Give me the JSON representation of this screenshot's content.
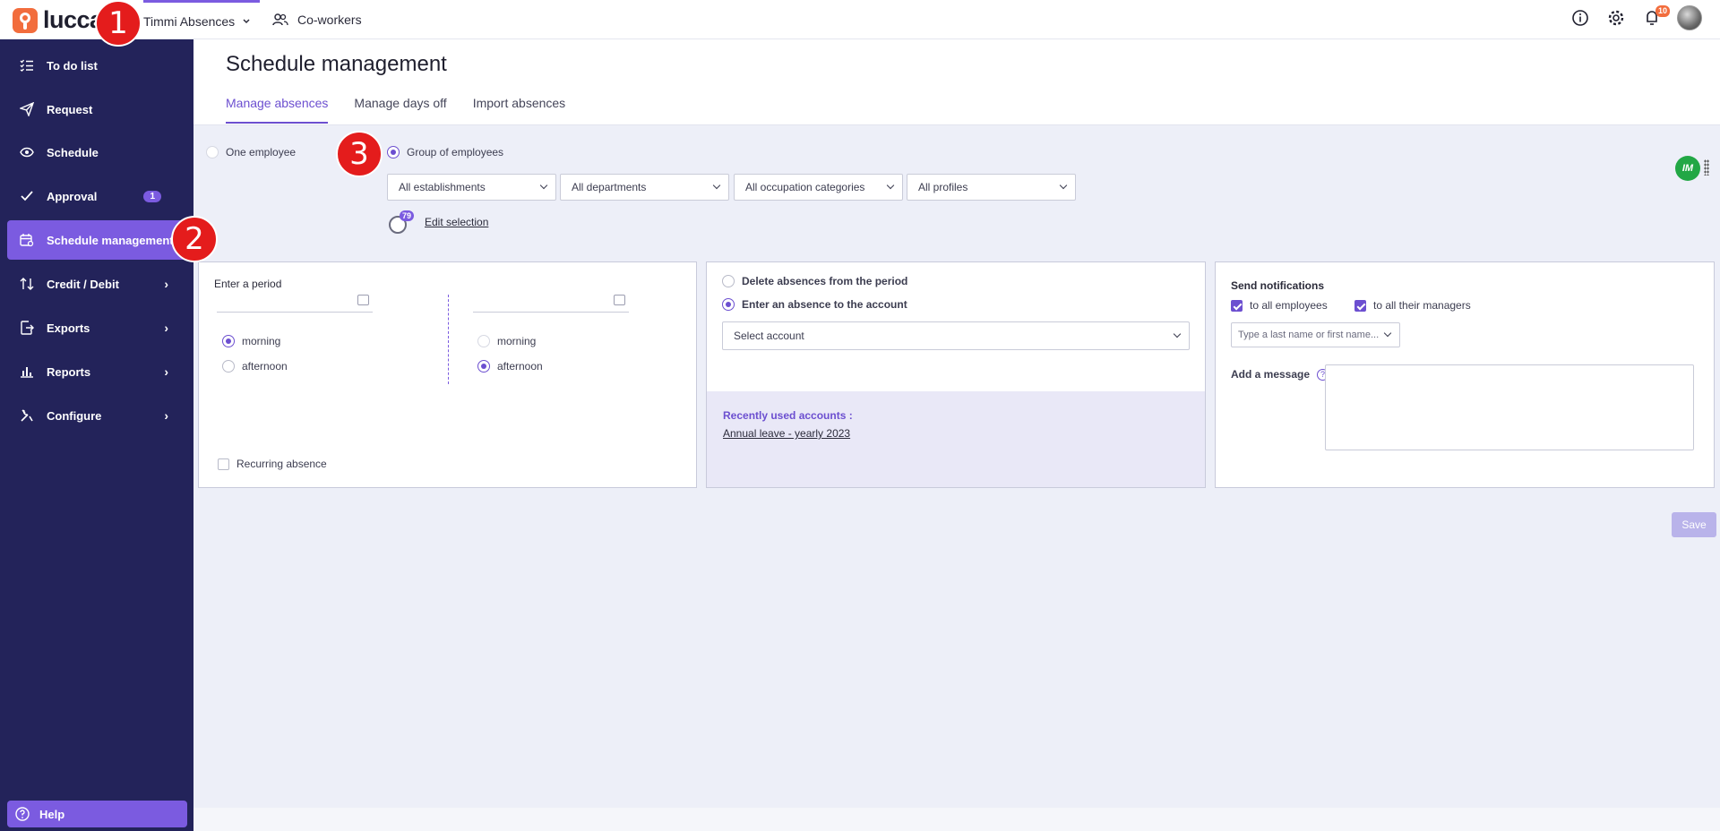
{
  "topbar": {
    "logo_text": "lucca",
    "app_switch_label": "Timmi Absences",
    "coworkers_label": "Co-workers",
    "notification_count": "10"
  },
  "sidebar": {
    "items": [
      {
        "label": "To do list",
        "icon": "checklist-icon"
      },
      {
        "label": "Request",
        "icon": "paper-plane-icon"
      },
      {
        "label": "Schedule",
        "icon": "eye-icon"
      },
      {
        "label": "Approval",
        "icon": "check-icon",
        "badge": "1"
      },
      {
        "label": "Schedule management",
        "icon": "calendar-settings-icon",
        "active": true
      },
      {
        "label": "Credit / Debit",
        "icon": "up-down-arrows-icon"
      },
      {
        "label": "Exports",
        "icon": "export-icon"
      },
      {
        "label": "Reports",
        "icon": "bar-chart-icon"
      },
      {
        "label": "Configure",
        "icon": "tools-icon"
      }
    ],
    "help_label": "Help"
  },
  "header": {
    "title": "Schedule management",
    "tabs": [
      {
        "label": "Manage absences",
        "active": true
      },
      {
        "label": "Manage days off"
      },
      {
        "label": "Import absences"
      }
    ]
  },
  "selection": {
    "one_employee_label": "One employee",
    "group_label": "Group of employees",
    "filters": [
      "All establishments",
      "All departments",
      "All occupation categories",
      "All profiles"
    ],
    "employee_count": "79",
    "edit_selection_label": "Edit selection"
  },
  "period_card": {
    "title": "Enter a period",
    "start": {
      "morning": "morning",
      "afternoon": "afternoon",
      "selected": "morning"
    },
    "end": {
      "morning": "morning",
      "afternoon": "afternoon",
      "selected": "afternoon"
    },
    "recurring_label": "Recurring absence"
  },
  "absence_card": {
    "delete_label": "Delete absences from the period",
    "enter_label": "Enter an absence to the account",
    "select_account_placeholder": "Select account",
    "recent_title": "Recently used accounts :",
    "recent_link": "Annual leave - yearly 2023"
  },
  "notify_card": {
    "title": "Send notifications",
    "all_employees_label": "to all employees",
    "all_managers_label": "to all their managers",
    "name_placeholder": "Type a last name or first name...",
    "message_label": "Add a message",
    "help_symbol": "?"
  },
  "save_label": "Save",
  "im_badge": "IM",
  "markers": [
    "1",
    "2",
    "3"
  ],
  "colors": {
    "accent": "#7b5be0",
    "sidebar_bg": "#23235a",
    "logo_orange": "#f26d3d",
    "marker_red": "#e41c1c"
  }
}
